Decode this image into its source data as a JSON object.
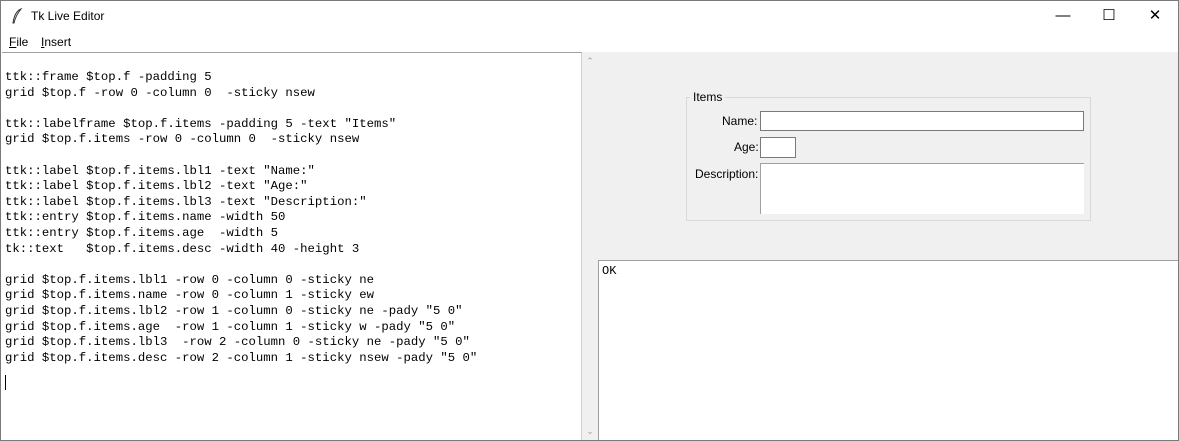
{
  "window": {
    "title": "Tk Live Editor",
    "controls": {
      "minimize": "—",
      "maximize": "☐",
      "close": "✕"
    }
  },
  "menu": {
    "file": {
      "mnemonic": "F",
      "rest": "ile"
    },
    "insert": {
      "mnemonic": "I",
      "rest": "nsert"
    }
  },
  "editor": {
    "code": "ttk::frame $top.f -padding 5\ngrid $top.f -row 0 -column 0  -sticky nsew\n\nttk::labelframe $top.f.items -padding 5 -text \"Items\"\ngrid $top.f.items -row 0 -column 0  -sticky nsew\n\nttk::label $top.f.items.lbl1 -text \"Name:\"\nttk::label $top.f.items.lbl2 -text \"Age:\"\nttk::label $top.f.items.lbl3 -text \"Description:\"\nttk::entry $top.f.items.name -width 50\nttk::entry $top.f.items.age  -width 5\ntk::text   $top.f.items.desc -width 40 -height 3\n\ngrid $top.f.items.lbl1 -row 0 -column 0 -sticky ne\ngrid $top.f.items.name -row 0 -column 1 -sticky ew\ngrid $top.f.items.lbl2 -row 1 -column 0 -sticky ne -pady \"5 0\"\ngrid $top.f.items.age  -row 1 -column 1 -sticky w -pady \"5 0\"\ngrid $top.f.items.lbl3  -row 2 -column 0 -sticky ne -pady \"5 0\"\ngrid $top.f.items.desc -row 2 -column 1 -sticky nsew -pady \"5 0\""
  },
  "preview": {
    "frame_title": "Items",
    "name_label": "Name:",
    "age_label": "Age:",
    "description_label": "Description:",
    "name_value": "",
    "age_value": ""
  },
  "output": {
    "text": "OK"
  },
  "scrollbar": {
    "up": "⌃",
    "down": "⌄"
  }
}
